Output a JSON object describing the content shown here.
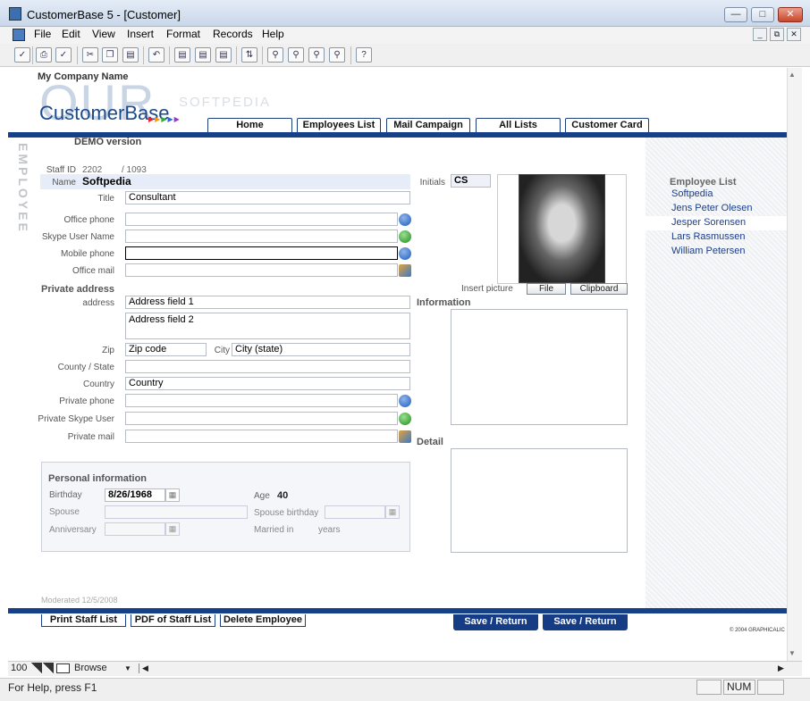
{
  "window": {
    "title": "CustomerBase 5 - [Customer]"
  },
  "menu": [
    "File",
    "Edit",
    "View",
    "Insert",
    "Format",
    "Records",
    "Help"
  ],
  "header": {
    "company": "My Company Name",
    "logo_big": "OUR",
    "logo_text": "CustomerBase",
    "watermark": "SOFTPEDIA",
    "demo": "DEMO version",
    "vertical_label": "EMPLOYEE"
  },
  "tabs": [
    "Home",
    "Employees List",
    "Mail Campaign",
    "All Lists",
    "Customer Card"
  ],
  "form": {
    "staff_id_label": "Staff ID",
    "staff_id": "2202",
    "staff_total": "/ 1093",
    "name_label": "Name",
    "name": "Softpedia",
    "initials_label": "Initials",
    "initials": "CS",
    "title_label": "Title",
    "title": "Consultant",
    "office_phone_label": "Office phone",
    "skype_label": "Skype User Name",
    "mobile_label": "Mobile phone",
    "office_mail_label": "Office mail",
    "private_address_heading": "Private address",
    "address_label": "address",
    "address1": "Address field 1",
    "address2": "Address field 2",
    "zip_label": "Zip",
    "zip": "Zip code",
    "city_label": "City",
    "city": "City (state)",
    "county_label": "County / State",
    "country_label": "Country",
    "country": "Country",
    "private_phone_label": "Private phone",
    "private_skype_label": "Private Skype User",
    "private_mail_label": "Private mail",
    "insert_picture_label": "Insert picture",
    "file_btn": "File",
    "clipboard_btn": "Clipboard",
    "information_heading": "Information",
    "detail_heading": "Detail"
  },
  "personal": {
    "heading": "Personal information",
    "birthday_label": "Birthday",
    "birthday": "8/26/1968",
    "age_label": "Age",
    "age": "40",
    "spouse_label": "Spouse",
    "spouse_birthday_label": "Spouse birthday",
    "anniversary_label": "Anniversary",
    "married_label": "Married in",
    "years_label": "years"
  },
  "moderated": "Moderated 12/5/2008",
  "employee_list": {
    "heading": "Employee List",
    "items": [
      "Softpedia",
      "Jens Peter Olesen",
      "Jesper Sorensen",
      "Lars Rasmussen",
      "William Petersen"
    ]
  },
  "footer_buttons": [
    "Print Staff List",
    "PDF of Staff List",
    "Delete Employee"
  ],
  "save_buttons": [
    "Save / Return",
    "Save / Return"
  ],
  "copyright": "© 2004 GRAPHICALIC",
  "bottom": {
    "zoom": "100",
    "mode": "Browse"
  },
  "status": {
    "help": "For Help, press F1",
    "num": "NUM"
  }
}
